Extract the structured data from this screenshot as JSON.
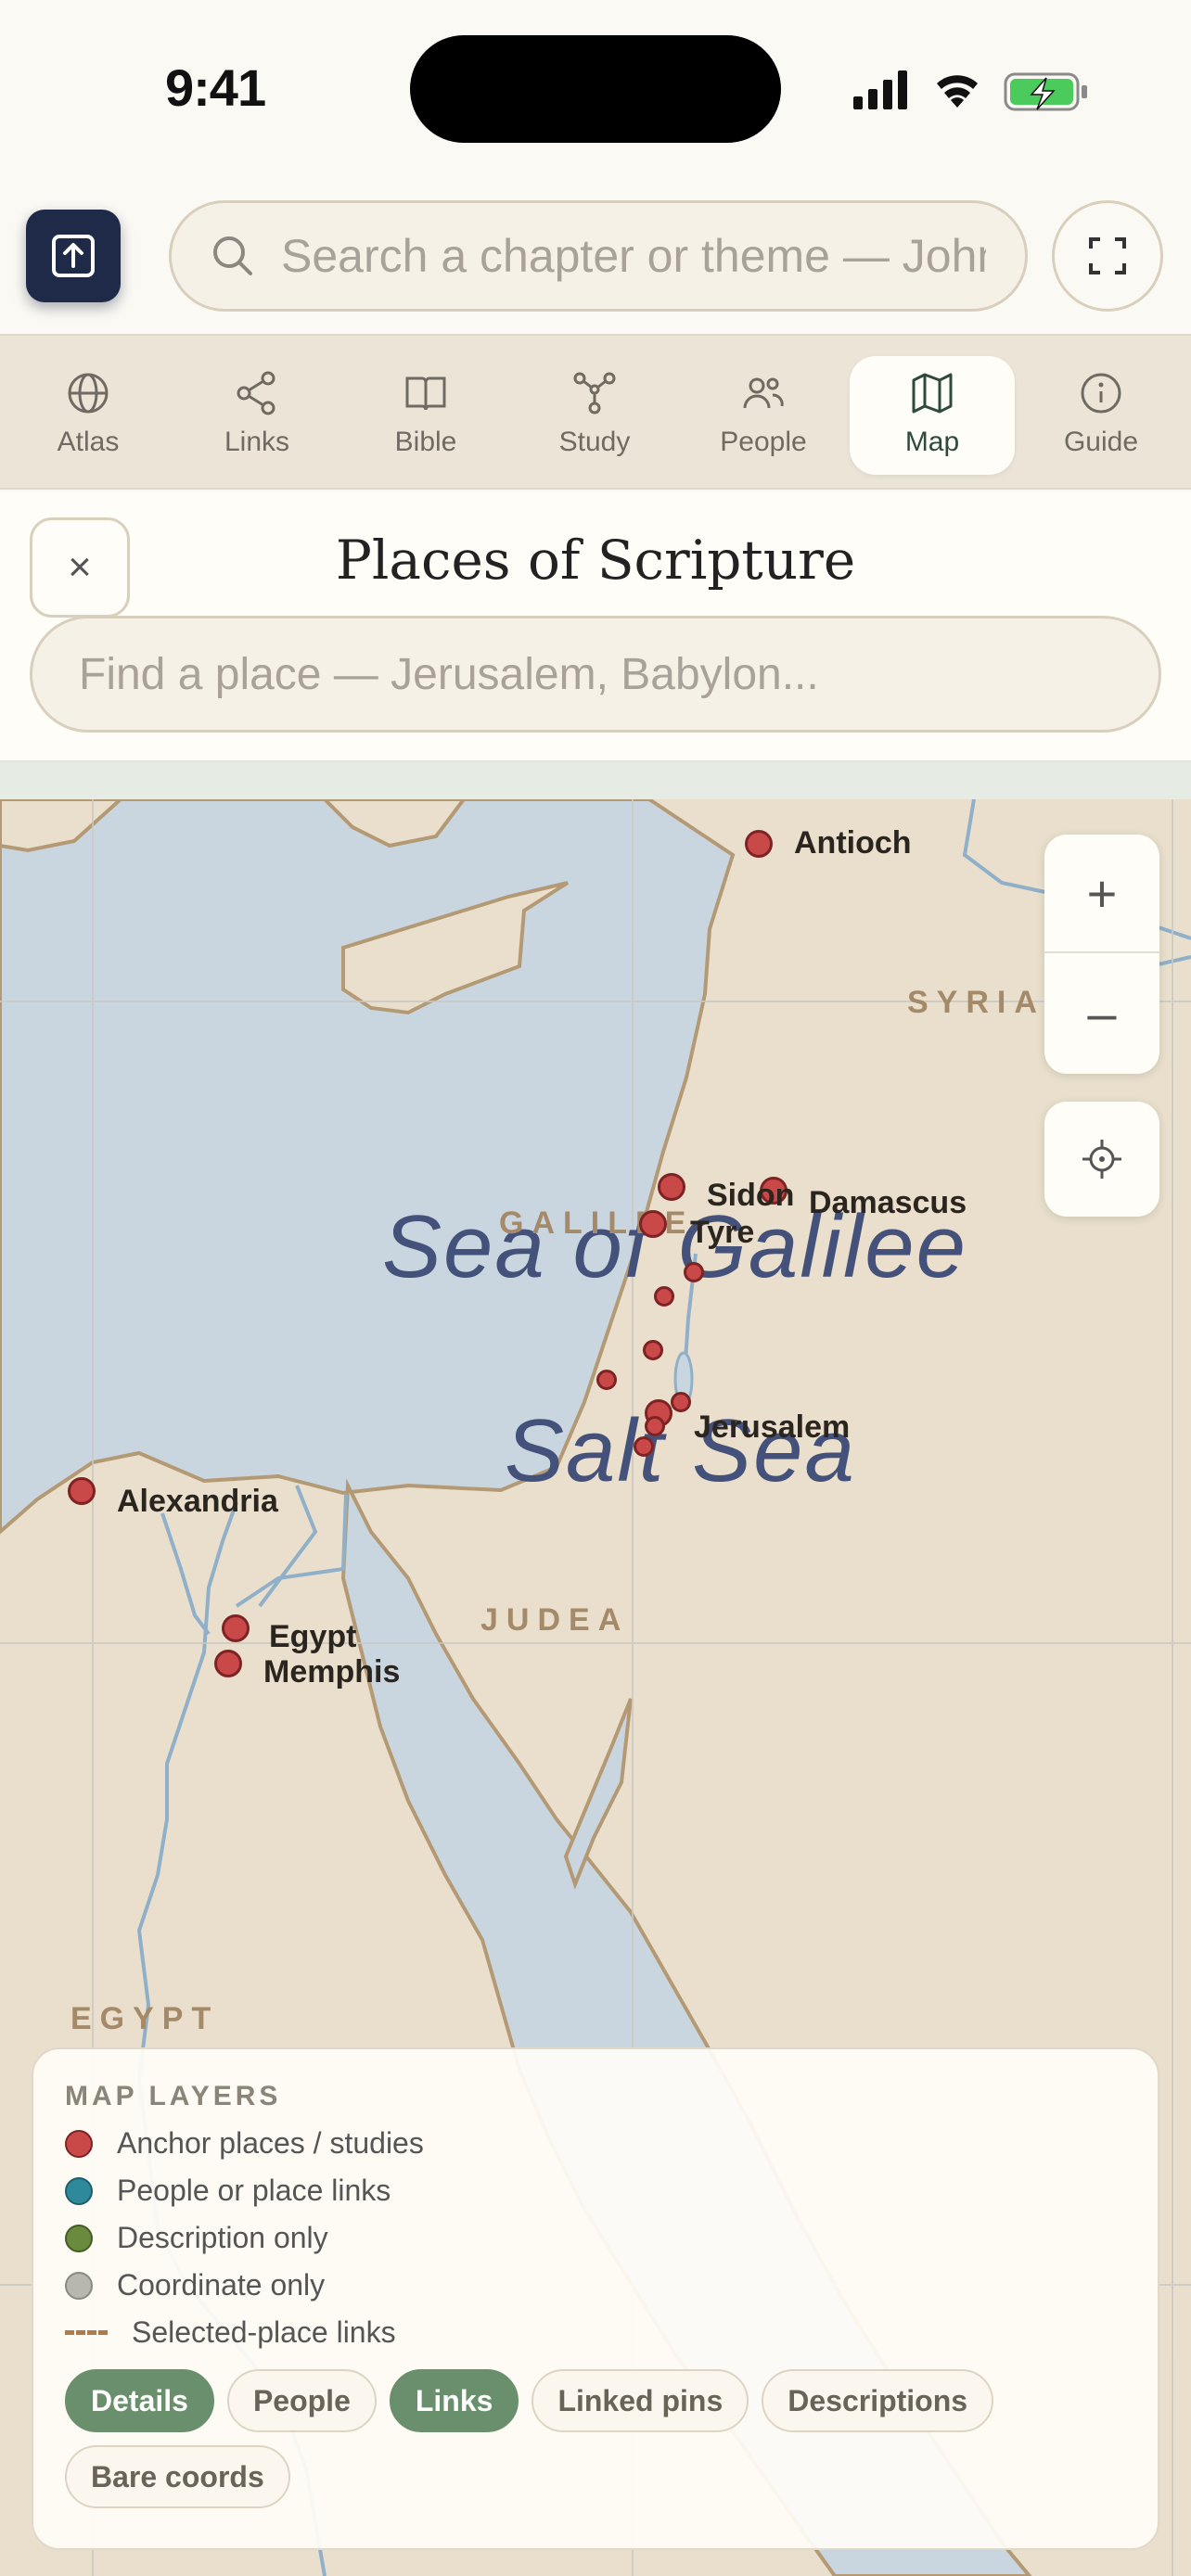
{
  "status_bar": {
    "time": "9:41"
  },
  "search": {
    "placeholder": "Search a chapter or theme — John 3:16, mercy"
  },
  "tabs": [
    {
      "label": "Atlas",
      "icon": "globe-icon"
    },
    {
      "label": "Links",
      "icon": "share-nodes-icon"
    },
    {
      "label": "Bible",
      "icon": "open-book-icon"
    },
    {
      "label": "Study",
      "icon": "graph-nodes-icon"
    },
    {
      "label": "People",
      "icon": "people-icon"
    },
    {
      "label": "Map",
      "icon": "map-icon",
      "active": true
    },
    {
      "label": "Guide",
      "icon": "info-circle-icon"
    }
  ],
  "panel": {
    "title": "Places of Scripture",
    "close_label": "×",
    "place_search_placeholder": "Find a place — Jerusalem, Babylon..."
  },
  "map": {
    "places": [
      "Antioch",
      "Sidon",
      "Damascus",
      "Tyre",
      "Jerusalem",
      "Alexandria",
      "Egypt",
      "Memphis"
    ],
    "regions": [
      "SYRIA",
      "GALILEE",
      "JUDEA",
      "EGYPT"
    ],
    "water": [
      "Sea of Galilee",
      "Salt Sea"
    ],
    "zoom_in": "+",
    "zoom_out": "–"
  },
  "legend": {
    "title": "MAP LAYERS",
    "items": [
      {
        "label": "Anchor places / studies",
        "color": "#c94848"
      },
      {
        "label": "People or place links",
        "color": "#2e8a9a"
      },
      {
        "label": "Description only",
        "color": "#6a8a3e"
      },
      {
        "label": "Coordinate only",
        "color": "#b7b7b0"
      },
      {
        "label": "Selected-place links",
        "color": "#b07a4a"
      }
    ],
    "chips": [
      {
        "label": "Details",
        "on": true
      },
      {
        "label": "People",
        "on": false
      },
      {
        "label": "Links",
        "on": true
      },
      {
        "label": "Linked pins",
        "on": false
      },
      {
        "label": "Descriptions",
        "on": false
      },
      {
        "label": "Bare coords",
        "on": false
      }
    ]
  },
  "colors": {
    "accent": "#6a8f6c",
    "pin": "#c94848",
    "sea": "#c9d6df",
    "land": "#e9dfcc"
  }
}
